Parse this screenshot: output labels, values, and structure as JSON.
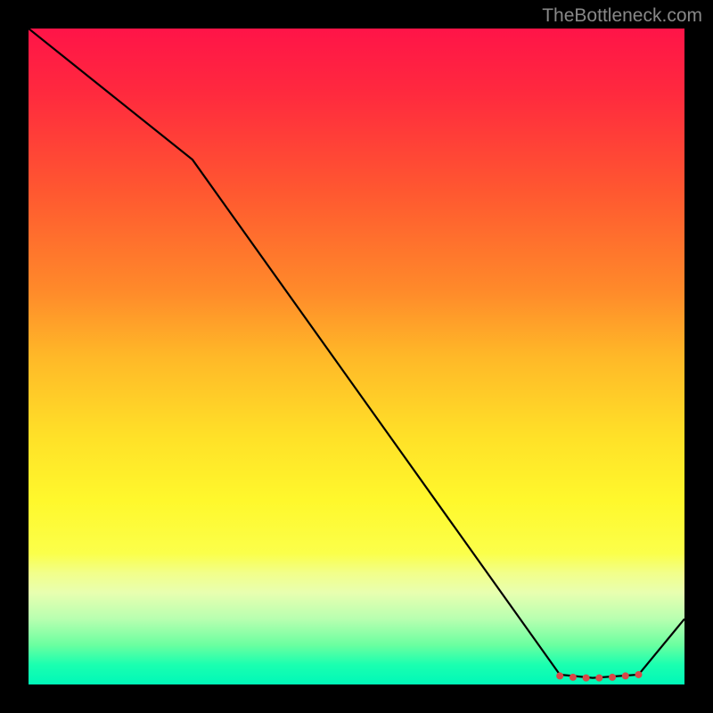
{
  "attribution": "TheBottleneck.com",
  "chart_data": {
    "type": "line",
    "title": "",
    "xlabel": "",
    "ylabel": "",
    "xlim": [
      0,
      100
    ],
    "ylim": [
      0,
      100
    ],
    "series": [
      {
        "name": "curve",
        "x": [
          0,
          25,
          81,
          86,
          93,
          100
        ],
        "values": [
          100,
          80,
          1.5,
          1.0,
          1.5,
          10
        ]
      }
    ],
    "markers": {
      "x": [
        81,
        83,
        85,
        87,
        89,
        91,
        93
      ],
      "y": [
        1.3,
        1.1,
        1.0,
        1.0,
        1.1,
        1.3,
        1.5
      ],
      "color": "#d84848",
      "size": 4
    },
    "background": "rainbow-vertical"
  }
}
